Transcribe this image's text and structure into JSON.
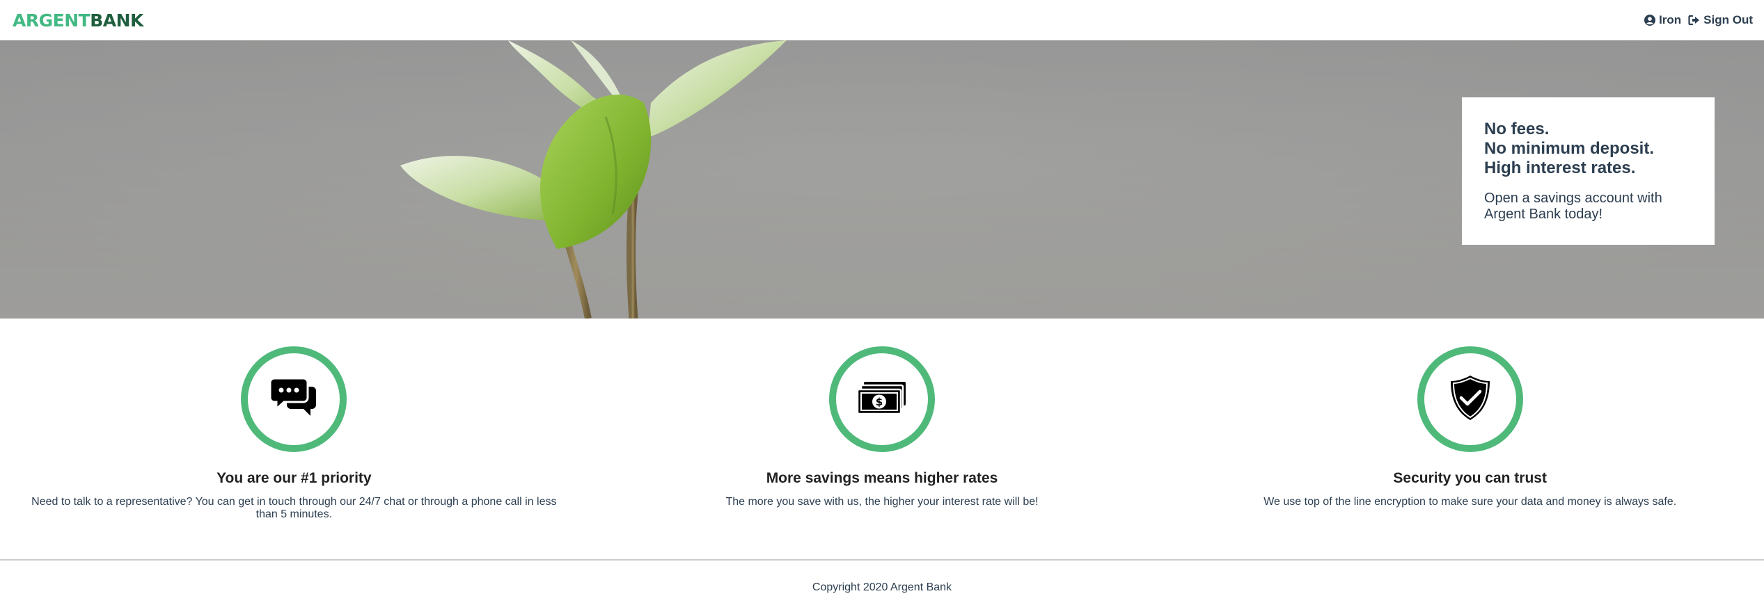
{
  "nav": {
    "logo_part1": "ARGENT",
    "logo_part2": "BANK",
    "user_icon": "user-circle-icon",
    "user_name": "Iron",
    "signout_icon": "sign-out-icon",
    "signout_label": "Sign Out"
  },
  "hero": {
    "image": "plant-sprout-photo",
    "subtitles": [
      "No fees.",
      "No minimum deposit.",
      "High interest rates."
    ],
    "text": "Open a savings account with Argent Bank today!"
  },
  "features": [
    {
      "icon": "chat-icon",
      "title": "You are our #1 priority",
      "text": "Need to talk to a representative? You can get in touch through our 24/7 chat or through a phone call in less than 5 minutes."
    },
    {
      "icon": "money-icon",
      "title": "More savings means higher rates",
      "text": "The more you save with us, the higher your interest rate will be!"
    },
    {
      "icon": "security-shield-icon",
      "title": "Security you can trust",
      "text": "We use top of the line encryption to make sure your data and money is always safe."
    }
  ],
  "footer": {
    "text": "Copyright 2020 Argent Bank"
  },
  "colors": {
    "accent": "#42b983",
    "icon_ring": "#4fb97a",
    "text": "#2c3e50"
  }
}
